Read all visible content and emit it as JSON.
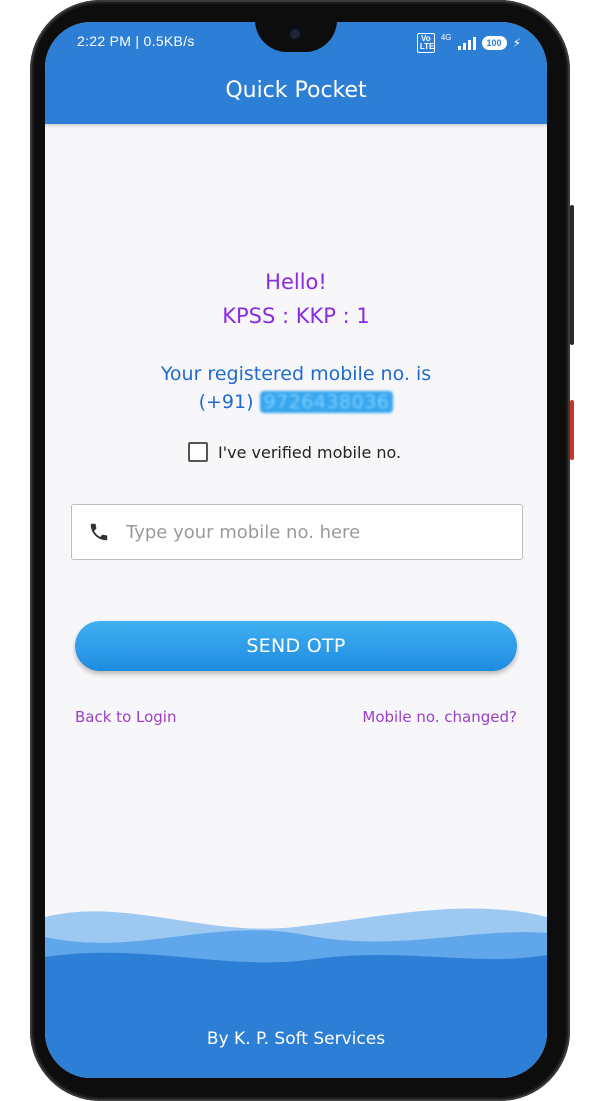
{
  "status_bar": {
    "time_speed": "2:22 PM | 0.5KB/s",
    "volte": "Vo LTE",
    "network": "4G",
    "battery": "100"
  },
  "app_bar": {
    "title": "Quick Pocket"
  },
  "greeting": {
    "hello": "Hello!",
    "code": "KPSS : KKP : 1"
  },
  "registration": {
    "line1": "Your registered mobile no. is",
    "prefix": "(+91)",
    "masked_number": "9726438036"
  },
  "verify": {
    "label": "I've verified mobile no.",
    "checked": false
  },
  "mobile_field": {
    "placeholder": "Type your mobile no. here",
    "value": ""
  },
  "actions": {
    "send_otp": "SEND OTP"
  },
  "links": {
    "back_to_login": "Back to Login",
    "mobile_changed": "Mobile no. changed?"
  },
  "footer": {
    "text": "By K. P. Soft Services"
  },
  "colors": {
    "primary": "#2d7fd6",
    "accent_purple": "#8a2be2",
    "link_purple": "#9b3fc8",
    "reg_blue": "#1f6ad1",
    "button_gradient": [
      "#41b0f2",
      "#1f8be0"
    ]
  },
  "icons": {
    "field_icon": "phone-icon",
    "status_charging": "bolt-icon"
  }
}
